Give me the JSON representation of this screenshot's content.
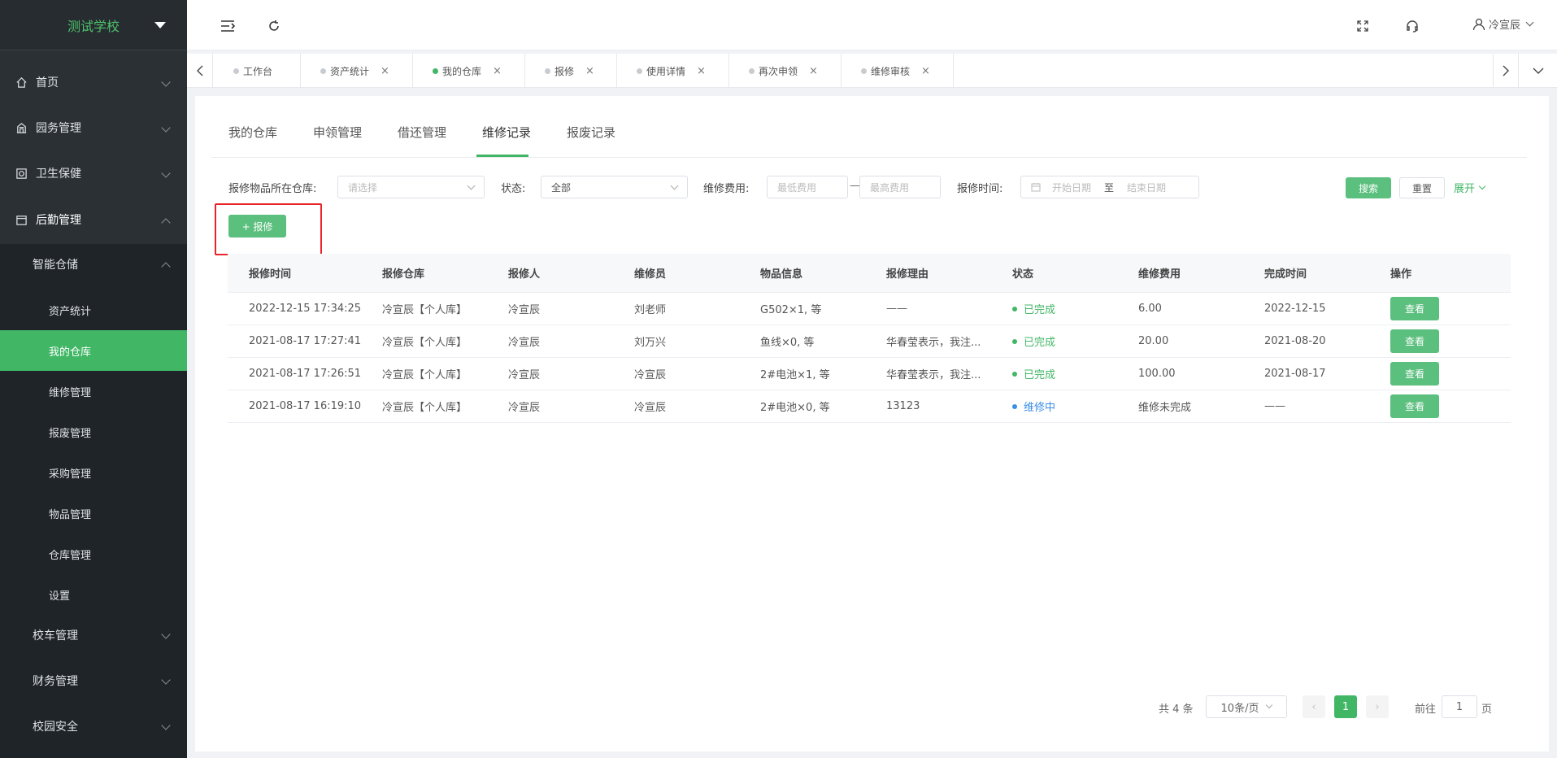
{
  "app": {
    "title": "测试学校"
  },
  "colors": {
    "accent": "#41b766",
    "sidebar_bg": "#2b3035",
    "submenu_bg": "#1f2428",
    "in_progress": "#3a8ee6",
    "highlight_box": "#e8232a"
  },
  "sidebar": {
    "menus": [
      {
        "label": "首页",
        "icon": "home-icon"
      },
      {
        "label": "园务管理",
        "icon": "building-icon"
      },
      {
        "label": "卫生保健",
        "icon": "health-icon"
      },
      {
        "label": "后勤管理",
        "icon": "logistics-icon"
      }
    ],
    "smart_storage": "智能仓储",
    "storage_items": [
      "资产统计",
      "我的仓库",
      "维修管理",
      "报废管理",
      "采购管理",
      "物品管理",
      "仓库管理",
      "设置"
    ],
    "other_menus": [
      "校车管理",
      "财务管理",
      "校园安全"
    ]
  },
  "header": {
    "user_name": "冷宣辰"
  },
  "tabs": [
    {
      "label": "工作台"
    },
    {
      "label": "资产统计"
    },
    {
      "label": "我的仓库"
    },
    {
      "label": "报修"
    },
    {
      "label": "使用详情"
    },
    {
      "label": "再次申领"
    },
    {
      "label": "维修审核"
    }
  ],
  "tab_close": "×",
  "subtabs": [
    "我的仓库",
    "申领管理",
    "借还管理",
    "维修记录",
    "报废记录"
  ],
  "filters": {
    "warehouse_label": "报修物品所在仓库:",
    "warehouse_placeholder": "请选择",
    "status_label": "状态:",
    "status_value": "全部",
    "cost_label": "维修费用:",
    "cost_min_placeholder": "最低费用",
    "cost_sep": "—",
    "cost_max_placeholder": "最高费用",
    "time_label": "报修时间:",
    "start_placeholder": "开始日期",
    "range_sep": "至",
    "end_placeholder": "结束日期",
    "search_btn": "搜索",
    "reset_btn": "重置",
    "expand_btn": "展开"
  },
  "actions": {
    "add_repair": "+ 报修"
  },
  "table": {
    "headers": [
      "报修时间",
      "报修仓库",
      "报修人",
      "维修员",
      "物品信息",
      "报修理由",
      "状态",
      "维修费用",
      "完成时间",
      "操作"
    ],
    "rows": [
      {
        "time": "2022-12-15 17:34:25",
        "warehouse": "冷宣辰【个人库】",
        "reporter": "冷宣辰",
        "repairer": "刘老师",
        "items": "G502×1, 等",
        "reason": "——",
        "status": "已完成",
        "status_type": "done",
        "cost": "6.00",
        "finish": "2022-12-15",
        "action": "查看"
      },
      {
        "time": "2021-08-17 17:27:41",
        "warehouse": "冷宣辰【个人库】",
        "reporter": "冷宣辰",
        "repairer": "刘万兴",
        "items": "鱼线×0, 等",
        "reason": "华春莹表示，我注...",
        "status": "已完成",
        "status_type": "done",
        "cost": "20.00",
        "finish": "2021-08-20",
        "action": "查看"
      },
      {
        "time": "2021-08-17 17:26:51",
        "warehouse": "冷宣辰【个人库】",
        "reporter": "冷宣辰",
        "repairer": "冷宣辰",
        "items": "2#电池×1, 等",
        "reason": "华春莹表示，我注...",
        "status": "已完成",
        "status_type": "done",
        "cost": "100.00",
        "finish": "2021-08-17",
        "action": "查看"
      },
      {
        "time": "2021-08-17 16:19:10",
        "warehouse": "冷宣辰【个人库】",
        "reporter": "冷宣辰",
        "repairer": "冷宣辰",
        "items": "2#电池×0, 等",
        "reason": "13123",
        "status": "维修中",
        "status_type": "prog",
        "cost": "维修未完成",
        "finish": "——",
        "action": "查看"
      }
    ]
  },
  "pagination": {
    "total": "共 4 条",
    "page_size": "10条/页",
    "current": "1",
    "goto_label": "前往",
    "goto_value": "1",
    "page_suffix": "页",
    "prev": "‹",
    "next": "›"
  }
}
